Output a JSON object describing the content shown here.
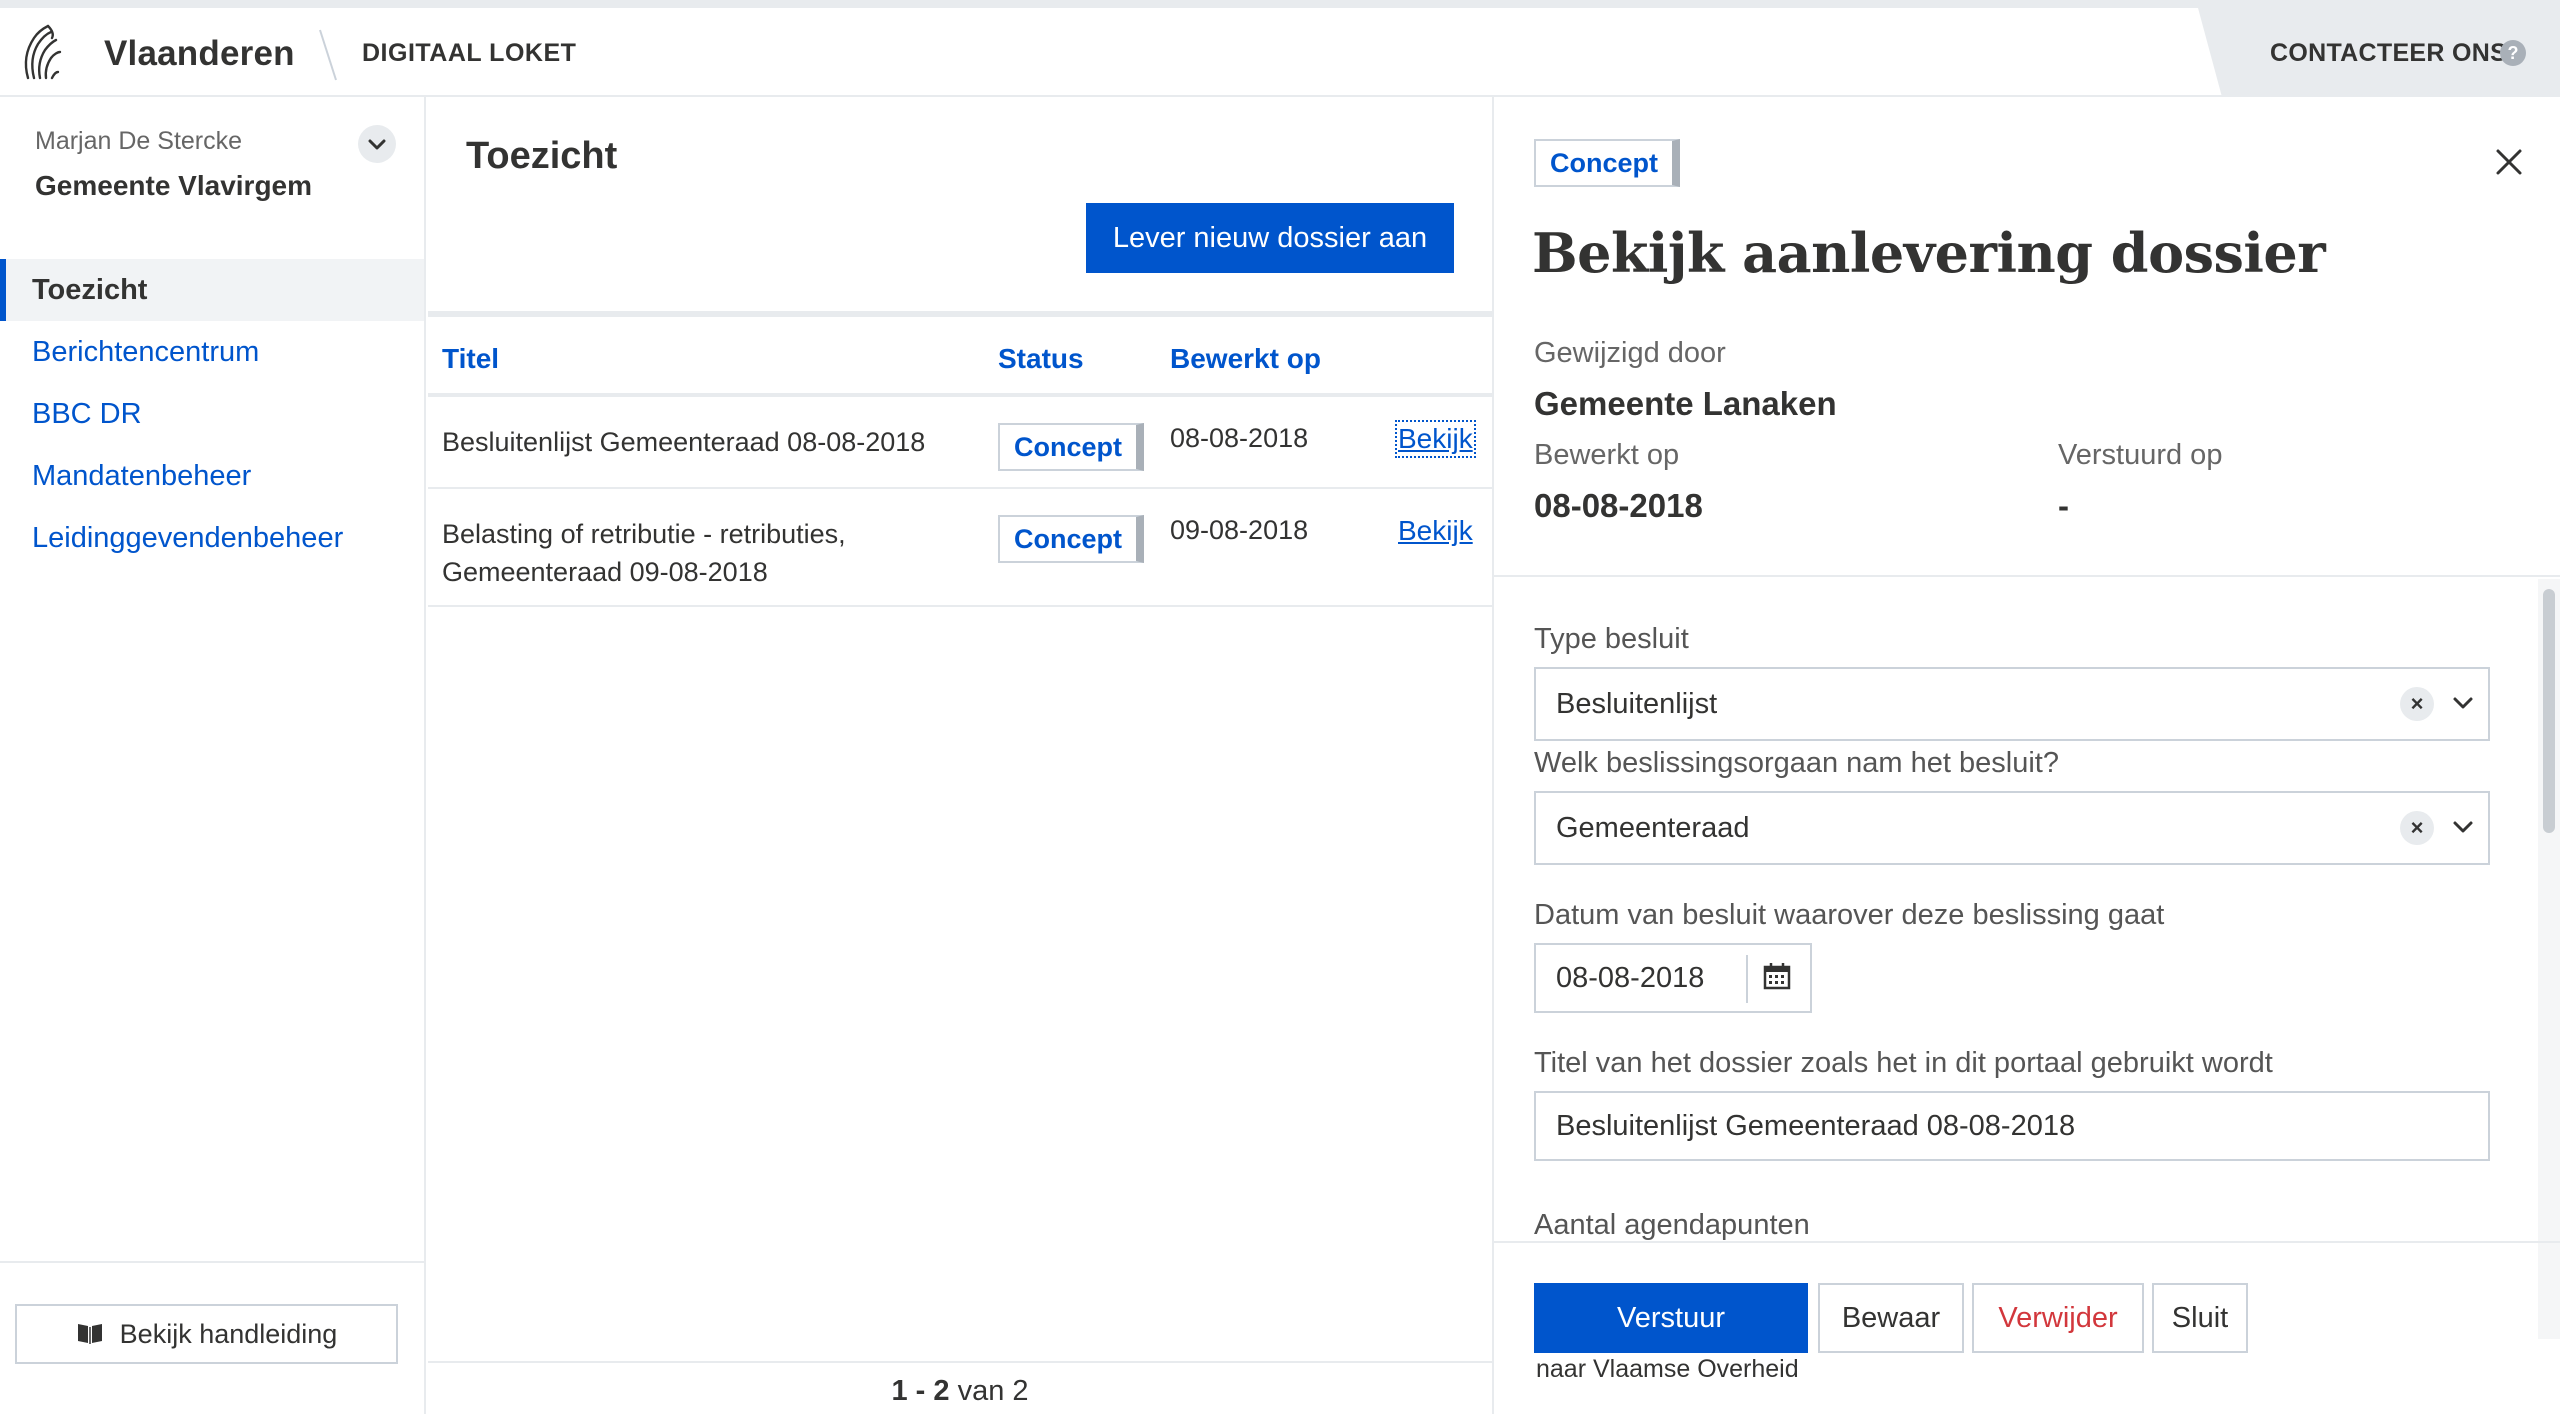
{
  "header": {
    "brand": "Vlaanderen",
    "app_name": "DIGITAAL LOKET",
    "contact_label": "CONTACTEER ONS",
    "help_glyph": "?"
  },
  "sidebar": {
    "user_name": "Marjan De Stercke",
    "org_name": "Gemeente Vlavirgem",
    "items": [
      {
        "label": "Toezicht",
        "active": true
      },
      {
        "label": "Berichtencentrum"
      },
      {
        "label": "BBC DR"
      },
      {
        "label": "Mandatenbeheer"
      },
      {
        "label": "Leidinggevendenbeheer"
      }
    ],
    "manual_button": "Bekijk handleiding"
  },
  "main": {
    "title": "Toezicht",
    "new_button": "Lever nieuw dossier aan",
    "columns": {
      "title": "Titel",
      "status": "Status",
      "edited": "Bewerkt op"
    },
    "rows": [
      {
        "title": "Besluitenlijst Gemeenteraad 08-08-2018",
        "status": "Concept",
        "date": "08-08-2018",
        "action": "Bekijk"
      },
      {
        "title": "Belasting of retributie - retributies, Gemeenteraad 09-08-2018",
        "status": "Concept",
        "date": "09-08-2018",
        "action": "Bekijk"
      }
    ],
    "pagination": {
      "range": "1 - 2",
      "of_label": "van 2"
    }
  },
  "panel": {
    "status_badge": "Concept",
    "title": "Bekijk aanlevering dossier",
    "modified_by_label": "Gewijzigd door",
    "modified_by_value": "Gemeente Lanaken",
    "edited_label": "Bewerkt op",
    "edited_value": "08-08-2018",
    "sent_label": "Verstuurd op",
    "sent_value": "-",
    "form": {
      "type_label": "Type besluit",
      "type_value": "Besluitenlijst",
      "organ_label": "Welk beslissingsorgaan nam het besluit?",
      "organ_value": "Gemeenteraad",
      "date_label": "Datum van besluit waarover deze beslissing gaat",
      "date_value": "08-08-2018",
      "dossier_title_label": "Titel van het dossier zoals het in dit portaal gebruikt wordt",
      "dossier_title_value": "Besluitenlijst Gemeenteraad 08-08-2018",
      "agenda_label": "Aantal agendapunten",
      "clear_glyph": "×"
    },
    "buttons": {
      "send": "Verstuur",
      "save": "Bewaar",
      "delete": "Verwijder",
      "close": "Sluit"
    },
    "send_note": "naar Vlaamse Overheid"
  },
  "colors": {
    "primary": "#0055cc",
    "danger": "#d2373c",
    "border": "#cbd2da",
    "surface": "#e8ebee"
  }
}
